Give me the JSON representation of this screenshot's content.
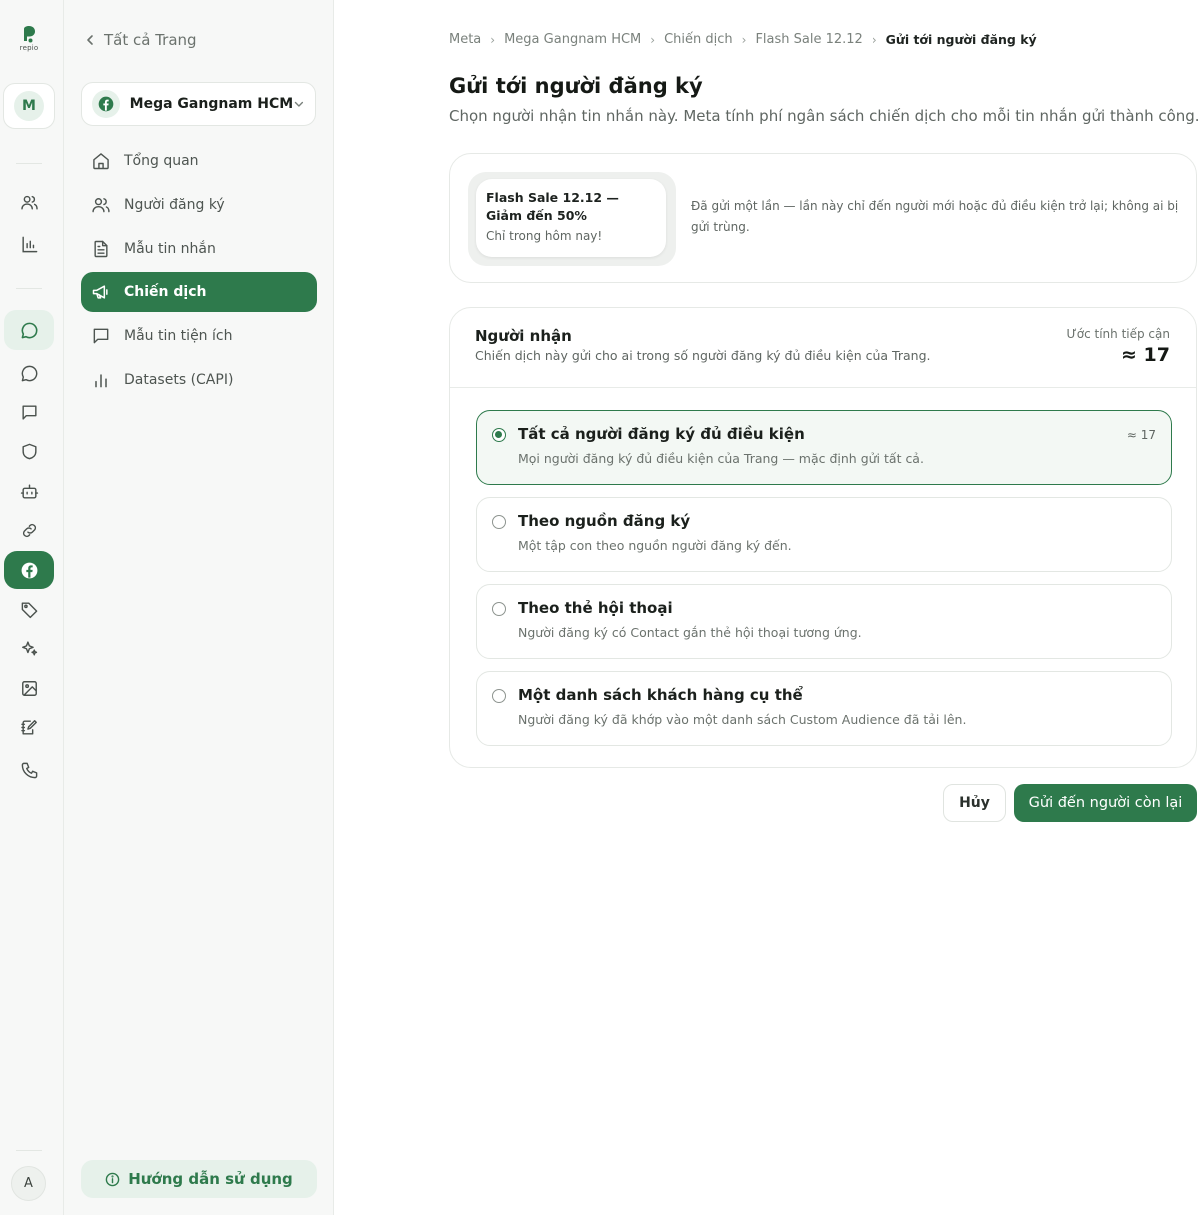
{
  "brand": {
    "logo_text": "repio",
    "accent": "#2e7a4c",
    "accent_soft": "#e6f1ea"
  },
  "rail": {
    "workspace_initial": "M",
    "user_initial": "A",
    "icons": [
      "users-icon",
      "bar-chart-icon",
      "chat-bubble-icon",
      "message-circle-icon",
      "message-square-icon",
      "shield-icon",
      "bot-icon",
      "link-icon",
      "facebook-icon",
      "tag-icon",
      "sparkles-icon",
      "image-icon",
      "notebook-edit-icon",
      "phone-icon"
    ]
  },
  "sidebar": {
    "back_label": "Tất cả Trang",
    "workspace_name": "Mega Gangnam HCM",
    "items": [
      {
        "label": "Tổng quan",
        "icon": "home-icon",
        "active": false
      },
      {
        "label": "Người đăng ký",
        "icon": "users-icon",
        "active": false
      },
      {
        "label": "Mẫu tin nhắn",
        "icon": "file-text-icon",
        "active": false
      },
      {
        "label": "Chiến dịch",
        "icon": "megaphone-icon",
        "active": true
      },
      {
        "label": "Mẫu tin tiện ích",
        "icon": "message-square-icon",
        "active": false
      },
      {
        "label": "Datasets (CAPI)",
        "icon": "bar-chart-icon",
        "active": false
      }
    ],
    "help_label": "Hướng dẫn sử dụng"
  },
  "breadcrumb": [
    "Meta",
    "Mega Gangnam HCM",
    "Chiến dịch",
    "Flash Sale 12.12",
    "Gửi tới người đăng ký"
  ],
  "page": {
    "title": "Gửi tới người đăng ký",
    "subtitle": "Chọn người nhận tin nhắn này. Meta tính phí ngân sách chiến dịch cho mỗi tin nhắn gửi thành công."
  },
  "message_preview": {
    "headline": "Flash Sale 12.12 — Giảm đến 50%",
    "body": "Chỉ trong hôm nay!",
    "note": "Đã gửi một lần — lần này chỉ đến người mới hoặc đủ điều kiện trở lại; không ai bị gửi trùng."
  },
  "recipients": {
    "title": "Người nhận",
    "description": "Chiến dịch này gửi cho ai trong số người đăng ký đủ điều kiện của Trang.",
    "estimate_label": "Ước tính tiếp cận",
    "estimate_value": "≈ 17",
    "options": [
      {
        "title": "Tất cả người đăng ký đủ điều kiện",
        "description": "Mọi người đăng ký đủ điều kiện của Trang — mặc định gửi tất cả.",
        "count": "≈ 17",
        "selected": true
      },
      {
        "title": "Theo nguồn đăng ký",
        "description": "Một tập con theo nguồn người đăng ký đến.",
        "count": "",
        "selected": false
      },
      {
        "title": "Theo thẻ hội thoại",
        "description": "Người đăng ký có Contact gắn thẻ hội thoại tương ứng.",
        "count": "",
        "selected": false
      },
      {
        "title": "Một danh sách khách hàng cụ thể",
        "description": "Người đăng ký đã khớp vào một danh sách Custom Audience đã tải lên.",
        "count": "",
        "selected": false
      }
    ]
  },
  "actions": {
    "cancel_label": "Hủy",
    "send_label": "Gửi đến người còn lại"
  }
}
